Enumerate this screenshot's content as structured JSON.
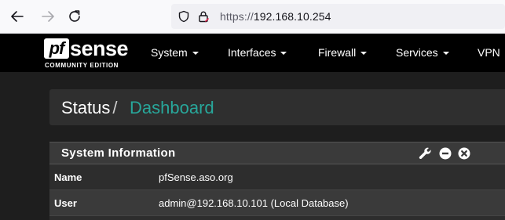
{
  "browser": {
    "url_scheme": "https://",
    "url_host": "192.168.10.254"
  },
  "navbar": {
    "logo_pf": "pf",
    "logo_sense": "sense",
    "logo_sub": "COMMUNITY EDITION",
    "menu": {
      "system": "System",
      "interfaces": "Interfaces",
      "firewall": "Firewall",
      "services": "Services",
      "vpn": "VPN"
    }
  },
  "breadcrumb": {
    "status": "Status",
    "separator": "/",
    "dashboard": "Dashboard"
  },
  "panel": {
    "title": "System Information",
    "rows": [
      {
        "label": "Name",
        "value": "pfSense.aso.org"
      },
      {
        "label": "User",
        "value": "admin@192.168.10.101 (Local Database)"
      }
    ]
  },
  "colors": {
    "accent": "#28a69a",
    "navbar": "#000000",
    "background": "#1e1e1e"
  },
  "icons": [
    "back-arrow-icon",
    "forward-arrow-icon",
    "reload-icon",
    "shield-icon",
    "lock-icon",
    "wrench-icon",
    "minus-circle-icon",
    "close-circle-icon"
  ]
}
